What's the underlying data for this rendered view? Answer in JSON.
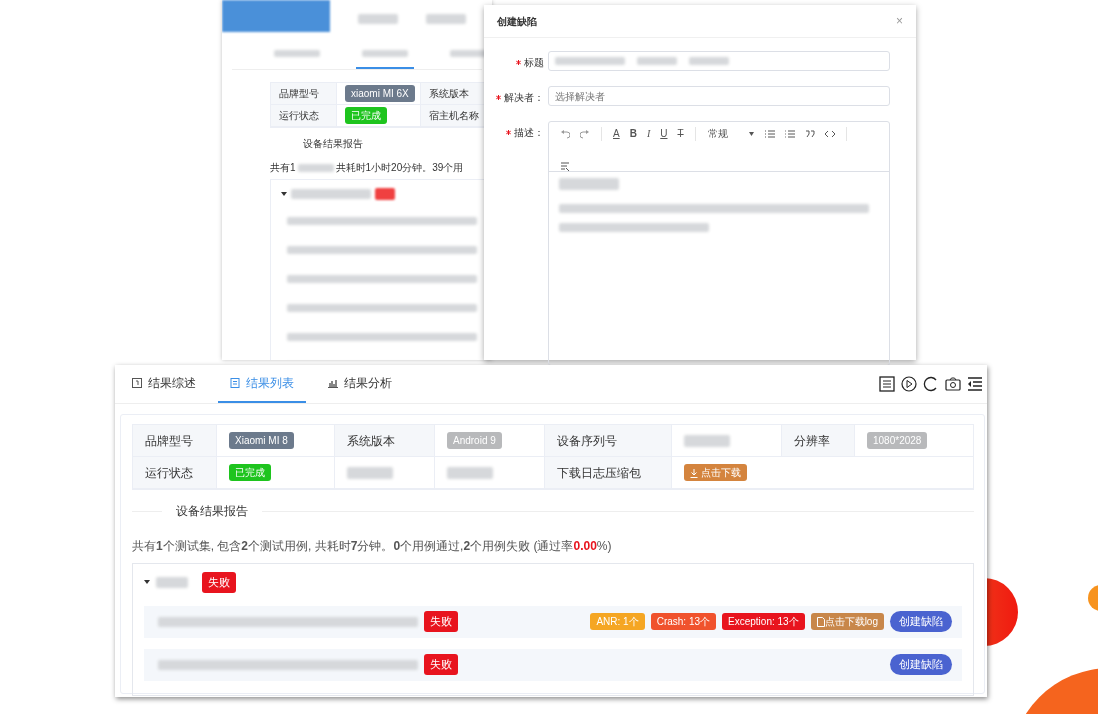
{
  "back_window": {
    "info_rows": [
      [
        {
          "kind": "label",
          "text": "品牌型号"
        },
        {
          "kind": "model",
          "text": "xiaomi MI 6X"
        },
        {
          "kind": "label",
          "text": "系统版本"
        }
      ],
      [
        {
          "kind": "label",
          "text": "运行状态"
        },
        {
          "kind": "status",
          "text": "已完成"
        },
        {
          "kind": "label",
          "text": "宿主机名称"
        }
      ]
    ],
    "section_title": "设备结果报告",
    "summary_parts": [
      "共有1",
      "共耗时1小时20分钟。39个用"
    ]
  },
  "dialog": {
    "title": "创建缺陷",
    "close": "×",
    "fields": [
      {
        "kind": "input",
        "label": "标题",
        "required": true
      },
      {
        "kind": "input",
        "label": "解决者：",
        "placeholder": "选择解决者",
        "required": true
      },
      {
        "kind": "editor",
        "label": "描述：",
        "required": true
      }
    ],
    "toolbar": [
      {
        "kind": "undo"
      },
      {
        "kind": "redo"
      },
      {
        "kind": "sep"
      },
      {
        "kind": "color",
        "text": "A"
      },
      {
        "kind": "bold",
        "text": "B"
      },
      {
        "kind": "italic",
        "text": "I"
      },
      {
        "kind": "underline",
        "text": "U"
      },
      {
        "kind": "strike",
        "text": "T"
      },
      {
        "kind": "sep"
      },
      {
        "kind": "format",
        "text": "常规"
      },
      {
        "kind": "bullets"
      },
      {
        "kind": "numbers"
      },
      {
        "kind": "quote"
      },
      {
        "kind": "code"
      },
      {
        "kind": "sep"
      },
      {
        "kind": "clear"
      }
    ]
  },
  "tabs": [
    {
      "label": "结果综述",
      "kind": "summary",
      "selected": false
    },
    {
      "label": "结果列表",
      "kind": "list",
      "selected": true
    },
    {
      "label": "结果分析",
      "kind": "chart",
      "selected": false
    }
  ],
  "info_rows": [
    [
      {
        "kind": "label",
        "text": "品牌型号"
      },
      {
        "kind": "model",
        "text": "Xiaomi MI 8"
      },
      {
        "kind": "label",
        "text": "系统版本"
      },
      {
        "kind": "version",
        "text": "Android 9"
      },
      {
        "kind": "label",
        "text": "设备序列号"
      },
      {
        "kind": "blurred"
      },
      {
        "kind": "label",
        "text": "分辨率"
      },
      {
        "kind": "version",
        "text": "1080*2028"
      }
    ],
    [
      {
        "kind": "label",
        "text": "运行状态"
      },
      {
        "kind": "status",
        "text": "已完成"
      },
      {
        "kind": "blurred"
      },
      {
        "kind": "blurred"
      },
      {
        "kind": "label",
        "text": "下载日志压缩包"
      },
      {
        "kind": "download",
        "text": "点击下载"
      }
    ]
  ],
  "section_title": "设备结果报告",
  "summary": {
    "text": "共有**1**个测试集, 包含**2**个测试用例, 共耗时**7**分钟。**0**个用例通过,**2**个用例失败 (通过率",
    "pass_rate": "0.00",
    "suffix": "%)"
  },
  "suite": {
    "expanded": true,
    "status": "失败",
    "cases": [
      {
        "status": "失败",
        "tags": [
          {
            "text": "ANR: 1个",
            "color": "#f5a623"
          },
          {
            "text": "Crash: 13个",
            "color": "#f0522d"
          },
          {
            "text": "Exception: 13个",
            "color": "#e8141e"
          }
        ],
        "log_button": "点击下载log",
        "defect_button": "创建缺陷"
      },
      {
        "status": "失败",
        "defect_button": "创建缺陷"
      }
    ]
  }
}
